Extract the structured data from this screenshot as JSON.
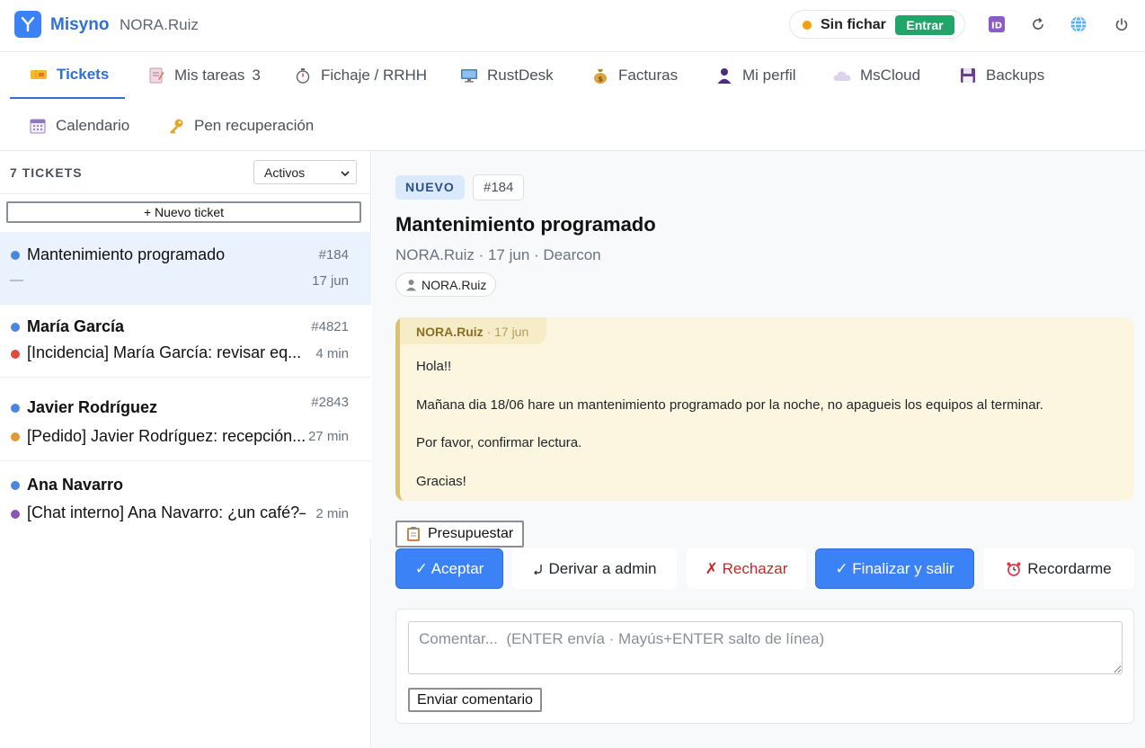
{
  "header": {
    "brand": "Misyno",
    "user": "NORA.Ruiz",
    "clock_status": "Sin fichar",
    "clock_button": "Entrar",
    "icons": [
      "id-icon",
      "refresh-icon",
      "globe-icon",
      "power-icon"
    ]
  },
  "tabs": [
    {
      "label": "Tickets",
      "icon": "ticket-icon",
      "active": true
    },
    {
      "label": "Mis tareas",
      "icon": "memo-icon",
      "count": "3"
    },
    {
      "label": "Fichaje / RRHH",
      "icon": "stopwatch-icon"
    },
    {
      "label": "RustDesk",
      "icon": "monitor-icon"
    },
    {
      "label": "Facturas",
      "icon": "money-bag-icon"
    },
    {
      "label": "Mi perfil",
      "icon": "user-icon"
    },
    {
      "label": "MsCloud",
      "icon": "cloud-icon"
    },
    {
      "label": "Backups",
      "icon": "floppy-icon"
    },
    {
      "label": "Calendario",
      "icon": "calendar-icon"
    },
    {
      "label": "Pen recuperación",
      "icon": "key-icon"
    }
  ],
  "ticket_list": {
    "count_label": "7 TICKETS",
    "filter_value": "Activos",
    "new_ticket": "+ Nuevo ticket",
    "items": [
      {
        "name": "Mantenimiento programado",
        "number": "#184",
        "sub": "—",
        "time": "17 jun",
        "selected": true
      },
      {
        "name": "María García",
        "number": "#4821",
        "sub": "[Incidencia] María García: revisar eq...",
        "time": "4 min"
      },
      {
        "name": "Javier Rodríguez",
        "number": "#2843",
        "sub": "[Pedido] Javier Rodríguez: recepción...",
        "time": "27 min"
      },
      {
        "name": "Ana Navarro",
        "number": "",
        "sub": "[Chat interno] Ana Navarro: ¿un café?—",
        "time": "2 min"
      }
    ]
  },
  "detail": {
    "status": "NUEVO",
    "id": "#184",
    "title": "Mantenimiento programado",
    "meta": "NORA.Ruiz · 17 jun · Dearcon",
    "assignee": "NORA.Ruiz",
    "message": {
      "author": "NORA.Ruiz",
      "date": "· 17 jun",
      "lines": [
        "Hola!!",
        "Mañana dia 18/06 hare un mantenimiento programado por la noche, no apagueis los equipos al terminar.",
        "Por favor, confirmar lectura.",
        "Gracias!"
      ]
    },
    "actions": {
      "presupuestar": "Presupuestar",
      "aceptar": "✓ Aceptar",
      "derivar": "Derivar a admin",
      "rechazar": "✗ Rechazar",
      "finalizar": "✓ Finalizar y salir",
      "recordarme": "Recordarme"
    },
    "comment": {
      "placeholder": "Comentar...  (ENTER envía · Mayús+ENTER salto de línea)",
      "value": "",
      "send": "Enviar comentario"
    }
  },
  "colors": {
    "accent": "#3b82f6",
    "clock_button": "#22a569",
    "dot_blue": "#4a86e0",
    "dot_red": "#e04b3f",
    "dot_orange": "#e09a36",
    "dot_purple": "#8e55b8",
    "message_bg": "#fcf6e1"
  }
}
